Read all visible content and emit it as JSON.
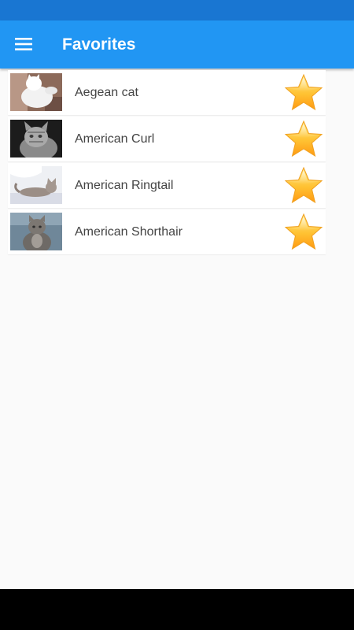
{
  "app_bar": {
    "title": "Favorites",
    "menu_icon": "hamburger-menu-icon",
    "color": "#2196f3",
    "status_bar_color": "#1976d2"
  },
  "favorites": [
    {
      "name": "Aegean cat",
      "thumbnail": "white-cat-photo",
      "favorite_icon": "gold-star-icon"
    },
    {
      "name": "American Curl",
      "thumbnail": "gray-tabby-cat-photo",
      "favorite_icon": "gold-star-icon"
    },
    {
      "name": "American Ringtail",
      "thumbnail": "lying-cat-photo",
      "favorite_icon": "gold-star-icon"
    },
    {
      "name": "American Shorthair",
      "thumbnail": "sitting-gray-cat-photo",
      "favorite_icon": "gold-star-icon"
    }
  ],
  "colors": {
    "star_top": "#ffe066",
    "star_bottom": "#ff9f1a",
    "background": "#fafafa"
  }
}
